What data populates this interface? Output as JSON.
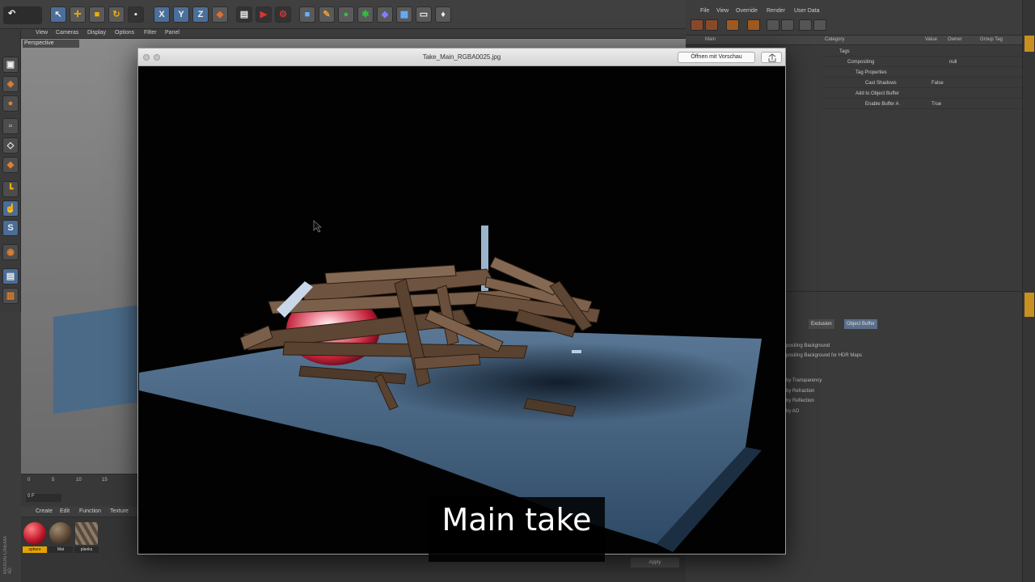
{
  "viewer": {
    "title": "Take_Main_RGBA0025.jpg",
    "open_preview_label": "Öffnen mit Vorschau"
  },
  "subtitle": "Main take",
  "viewport": {
    "label": "Perspective",
    "menu": [
      "View",
      "Cameras",
      "Display",
      "Options",
      "Filter",
      "Panel"
    ]
  },
  "timeline": {
    "ticks": [
      "0",
      "5",
      "10",
      "15"
    ],
    "current_frame": "0 F"
  },
  "materials": {
    "menu": [
      "Create",
      "Edit",
      "Function",
      "Texture"
    ],
    "items": [
      {
        "name": "sphere",
        "color": "#c0182a",
        "selected": true
      },
      {
        "name": "Mat",
        "color": "#5a4634",
        "selected": false
      },
      {
        "name": "planks",
        "color": "#7a6a5a",
        "selected": false
      }
    ]
  },
  "right_menu": [
    "File",
    "View",
    "Override",
    "Render",
    "User Data"
  ],
  "take_tree": {
    "headers": {
      "main": "Main",
      "category": "Category",
      "value": "Value",
      "owner": "Owner",
      "group_tag": "Group Tag"
    },
    "rows": [
      {
        "name": "Tags",
        "value": ""
      },
      {
        "name": "Compositing",
        "value": "null"
      },
      {
        "name": "Tag Properties",
        "value": ""
      },
      {
        "name": "Cast Shadows",
        "value": "False"
      },
      {
        "name": "Add to Object Buffer",
        "value": ""
      },
      {
        "name": "Enable Buffer A",
        "value": "True"
      }
    ]
  },
  "attributes": {
    "tabs": [
      "Exclusion",
      "Object Buffer"
    ],
    "rows": [
      "positing Background",
      "positing Background for HDR Maps",
      "by Transparency",
      "by Refraction",
      "by Reflection",
      "by AO"
    ]
  },
  "apply_label": "Apply",
  "logo_text": "MAXON CINEMA 4D",
  "colors": {
    "accent_blue": "#4b6f9a",
    "selected_material": "#e5a300",
    "floor": "#3c5a78",
    "sphere": "#c0182a"
  }
}
